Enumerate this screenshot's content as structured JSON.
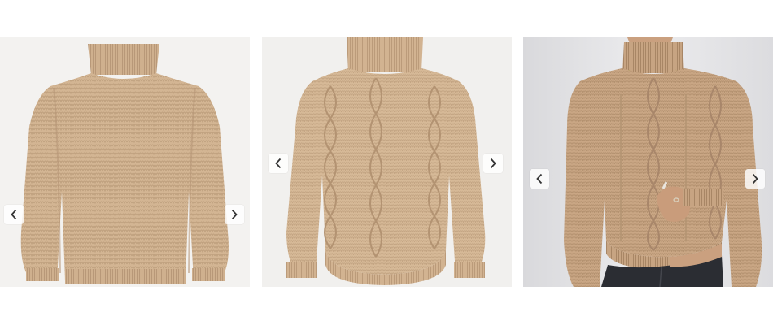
{
  "carousels": [
    {
      "image": "sweater-front-flat-knit",
      "prev_icon": "chevron-left-icon",
      "next_icon": "chevron-right-icon"
    },
    {
      "image": "sweater-cable-knit-flat",
      "prev_icon": "chevron-left-icon",
      "next_icon": "chevron-right-icon"
    },
    {
      "image": "sweater-cable-knit-on-model",
      "prev_icon": "chevron-left-icon",
      "next_icon": "chevron-right-icon"
    }
  ],
  "colors": {
    "sweater": "#d1b391",
    "sweater_shadow": "#b99a78",
    "background_light": "#f1f0ee",
    "wall": "#e4e4e6",
    "jeans": "#2b2d33",
    "skin": "#caa07f"
  }
}
